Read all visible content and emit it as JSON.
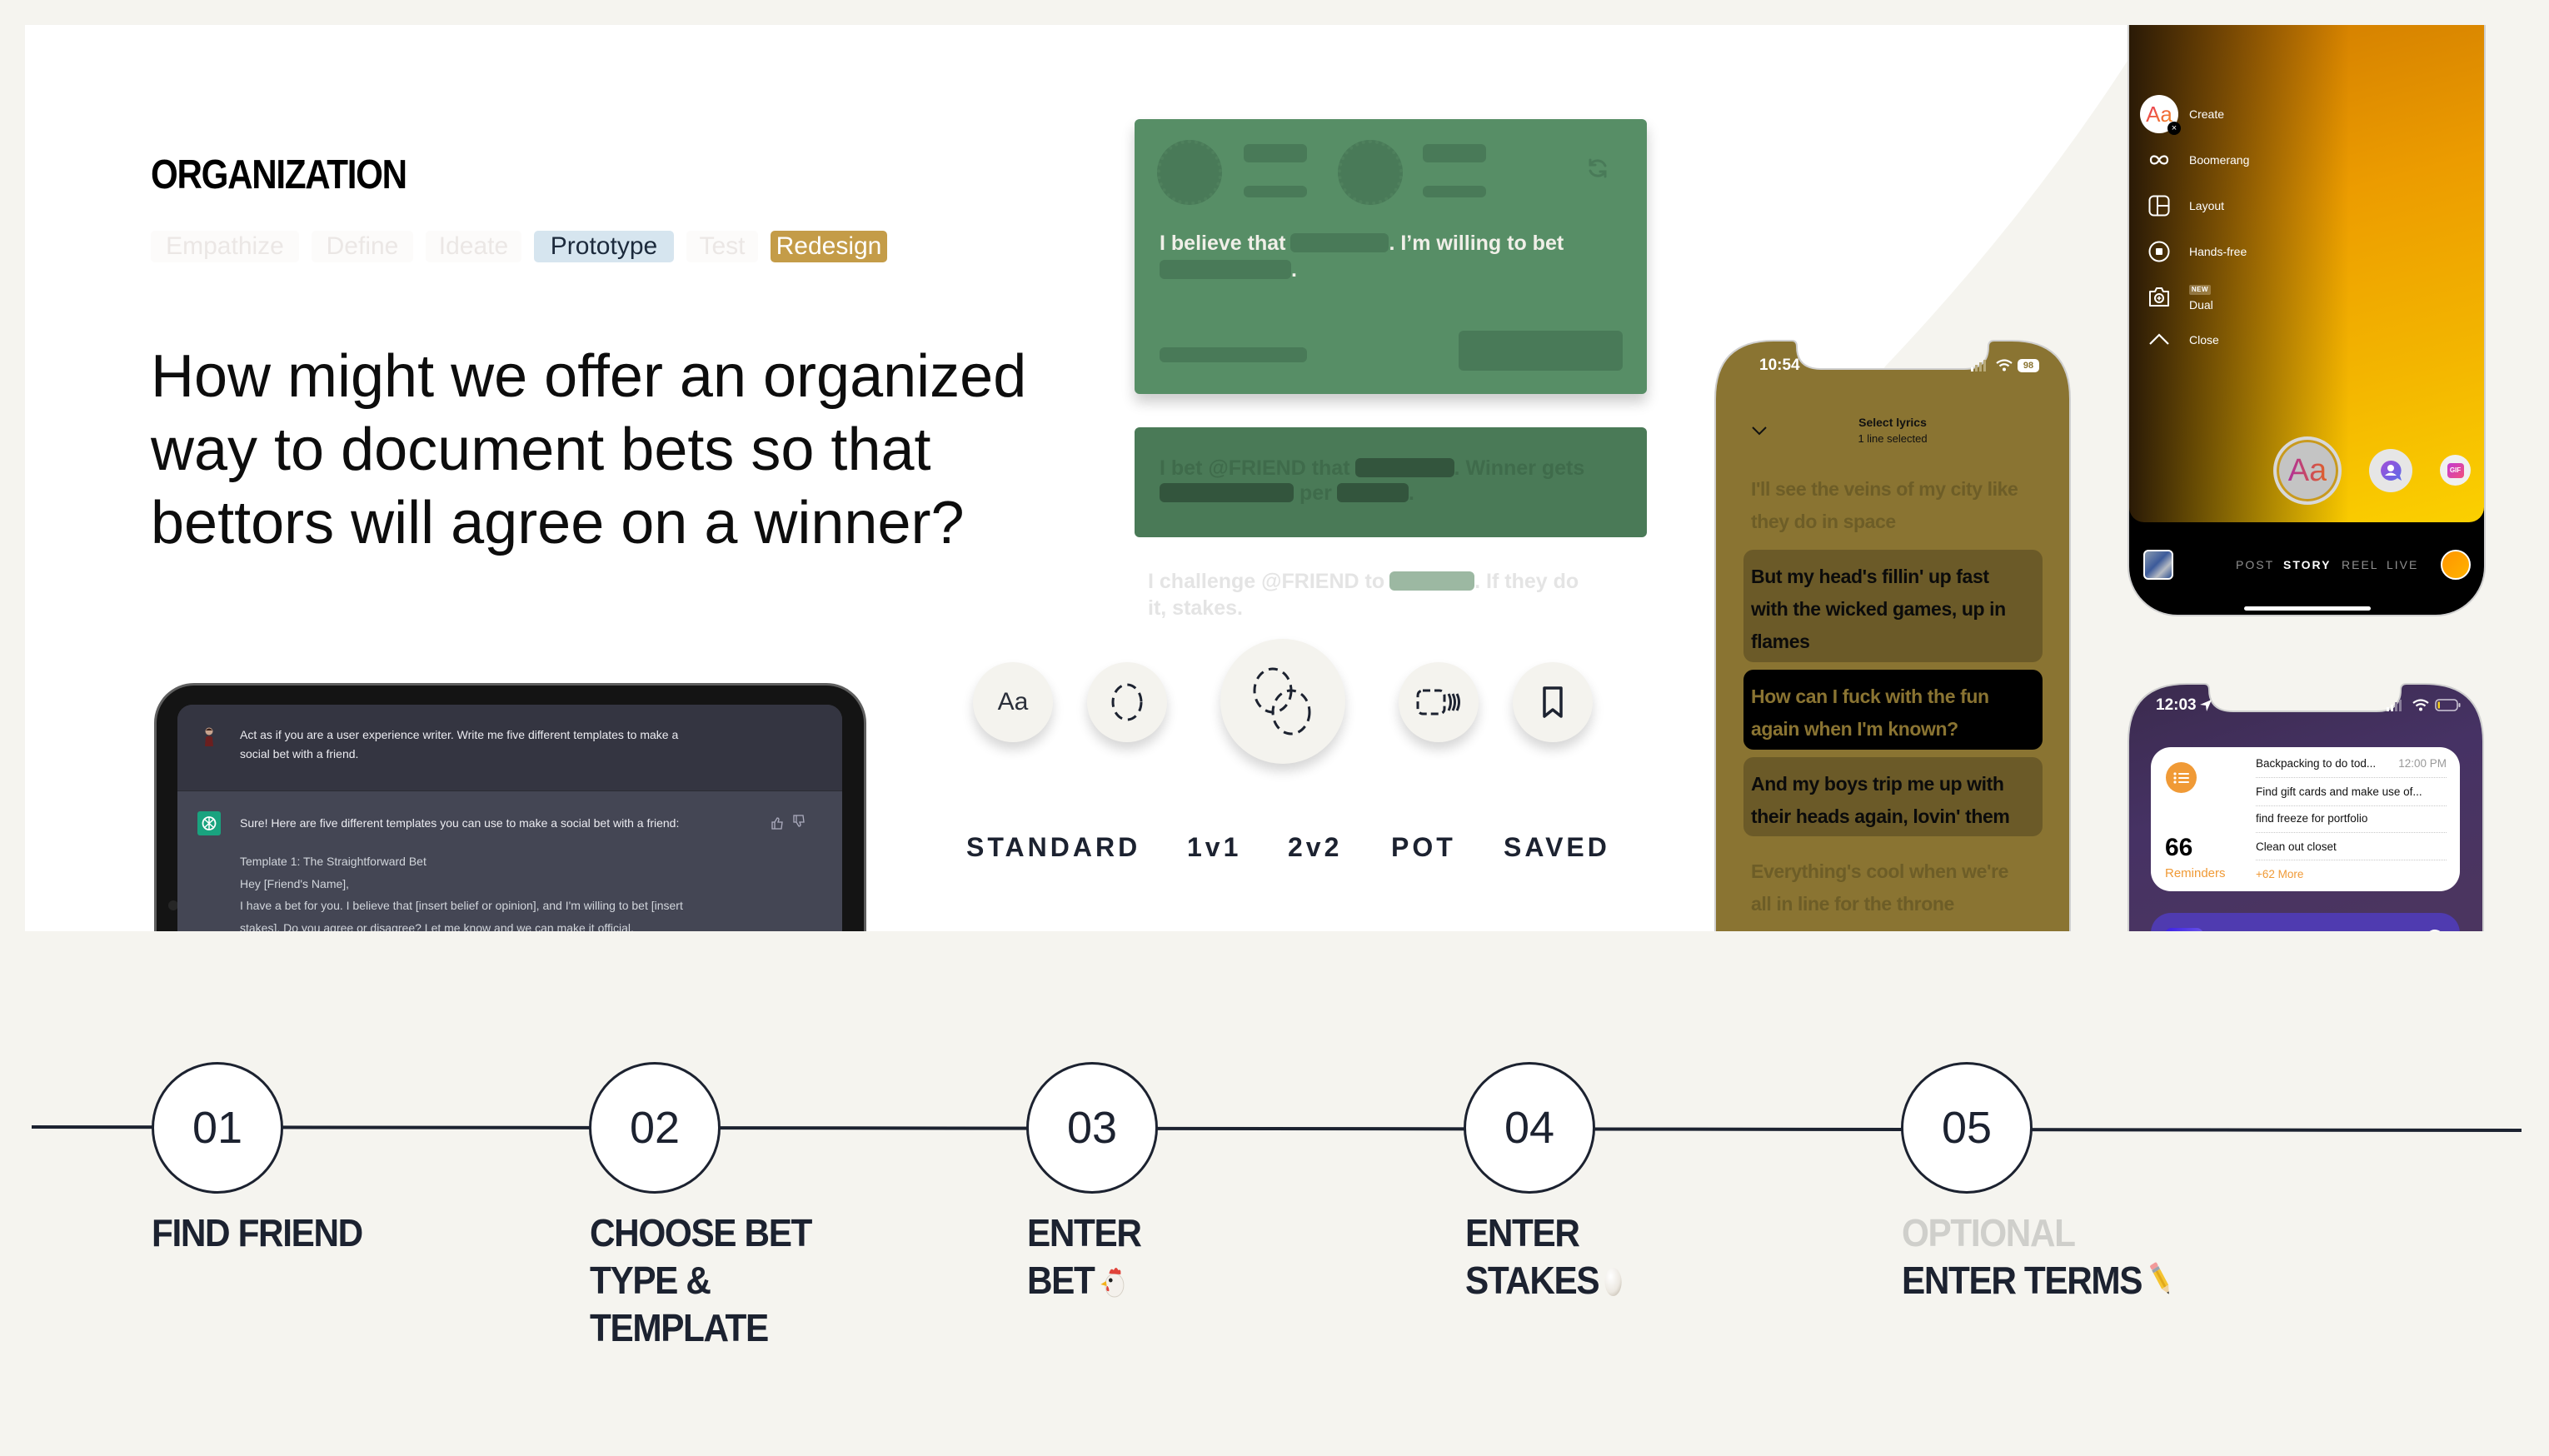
{
  "colors": {
    "page_bg": "#f5f4ef",
    "card_bg": "#ffffff",
    "text_dark": "#1c2230",
    "tag_current_bg": "#d6e5ef",
    "tag_highlight_bg": "#c49c48",
    "template_green": "#578e66",
    "template_green_dark": "#4a7a57",
    "lyrics_olive": "#8a7432",
    "reminders_orange": "#f09a36"
  },
  "section": {
    "title": "ORGANIZATION"
  },
  "process_tags": [
    {
      "label": "Empathize",
      "state": "inactive"
    },
    {
      "label": "Define",
      "state": "inactive"
    },
    {
      "label": "Ideate",
      "state": "inactive"
    },
    {
      "label": "Prototype",
      "state": "current"
    },
    {
      "label": "Test",
      "state": "inactive"
    },
    {
      "label": "Redesign",
      "state": "highlighted"
    }
  ],
  "hmw_question": {
    "lines": [
      "How might we offer an organized",
      "way to document bets so that",
      "bettors will agree on a winner?"
    ]
  },
  "chatgpt": {
    "user_avatar_icon": "user-avatar-icon",
    "user_prompt_lines": [
      "Act as if you are a user experience writer. Write me five different templates to make a",
      "social bet with a friend."
    ],
    "assistant_icon": "openai-logo-icon",
    "response_intro": "Sure! Here are five different templates you can use to make a social bet with a friend:",
    "response_lines": [
      "Template 1: The Straightforward Bet",
      "Hey [Friend's Name],",
      "I have a bet for you. I believe that [insert belief or opinion], and I'm willing to bet [insert",
      "stakes]. Do you agree or disagree? Let me know and we can make it official."
    ],
    "feedback_icons": [
      "thumbs-up-icon",
      "thumbs-down-icon"
    ]
  },
  "bet_templates": {
    "standard": {
      "segments": [
        "I believe that",
        ". I’m willing to bet",
        "."
      ],
      "icon": "refresh-icon"
    },
    "pot": {
      "segments": [
        "I bet @FRIEND that",
        ". Winner gets",
        "per",
        "."
      ]
    },
    "challenge": {
      "segments": [
        "I challenge @FRIEND to",
        ". If they do",
        "it, stakes."
      ]
    }
  },
  "bet_types": [
    {
      "label": "STANDARD",
      "icon": "text-aa-icon",
      "glyph": "Aa"
    },
    {
      "label": "1v1",
      "icon": "dashed-circle-icon"
    },
    {
      "label": "2v2",
      "icon": "two-dashed-circles-icon",
      "selected": true
    },
    {
      "label": "POT",
      "icon": "coin-stack-icon"
    },
    {
      "label": "SAVED",
      "icon": "bookmark-icon"
    }
  ],
  "lyrics_phone": {
    "status_time": "10:54",
    "battery": "98",
    "header_title": "Select lyrics",
    "header_subtitle": "1 line selected",
    "lyrics": [
      {
        "state": "faded",
        "lines": [
          "I'll see the veins of my city like",
          "they do in space"
        ]
      },
      {
        "state": "selected",
        "lines": [
          "But my head's fillin' up fast",
          "with the wicked games, up in",
          "flames"
        ]
      },
      {
        "state": "active",
        "lines": [
          "How can I fuck with the fun",
          "again when I'm known?"
        ]
      },
      {
        "state": "selected",
        "lines": [
          "And my boys trip me up with",
          "their heads again, lovin' them"
        ]
      },
      {
        "state": "faded",
        "lines": [
          "Everything's cool when we're",
          "all in line for the throne"
        ]
      }
    ]
  },
  "story_phone": {
    "menu": [
      {
        "label": "Create",
        "icon": "text-create-icon",
        "glyph": "Aa"
      },
      {
        "label": "Boomerang",
        "icon": "infinity-icon"
      },
      {
        "label": "Layout",
        "icon": "layout-icon"
      },
      {
        "label": "Hands-free",
        "icon": "hands-free-record-icon"
      },
      {
        "label": "Dual",
        "icon": "dual-camera-icon",
        "badge": "NEW"
      },
      {
        "label": "Close",
        "icon": "chevron-up-icon"
      }
    ],
    "tools": [
      {
        "icon": "text-tool-icon",
        "glyph": "Aa",
        "selected": true
      },
      {
        "icon": "avatar-sticker-icon"
      },
      {
        "icon": "gif-icon",
        "glyph": "GIF"
      }
    ],
    "modes": [
      {
        "label": "POST",
        "state": "inactive"
      },
      {
        "label": "STORY",
        "state": "active"
      },
      {
        "label": "REEL",
        "state": "inactive"
      },
      {
        "label": "LIVE",
        "state": "inactive"
      }
    ]
  },
  "reminders_phone": {
    "status_time": "12:03",
    "widget": {
      "count": "66",
      "title": "Reminders",
      "items": [
        {
          "text": "Backpacking to do tod...",
          "time": "12:00 PM"
        },
        {
          "text": "Find gift cards and make use of..."
        },
        {
          "text": "find freeze for portfolio"
        },
        {
          "text": "Clean out closet"
        }
      ],
      "more": "+62 More"
    }
  },
  "timeline": {
    "steps": [
      {
        "number": "01",
        "lines": [
          "FIND FRIEND"
        ]
      },
      {
        "number": "02",
        "lines": [
          "CHOOSE BET",
          "TYPE &",
          "TEMPLATE"
        ]
      },
      {
        "number": "03",
        "lines": [
          "ENTER",
          "BET"
        ],
        "emoji": "chicken-emoji"
      },
      {
        "number": "04",
        "lines": [
          "ENTER",
          "STAKES"
        ],
        "emoji": "egg-emoji"
      },
      {
        "number": "05",
        "optional_label": "OPTIONAL",
        "lines": [
          "ENTER TERMS"
        ],
        "emoji": "pencil-emoji"
      }
    ]
  }
}
